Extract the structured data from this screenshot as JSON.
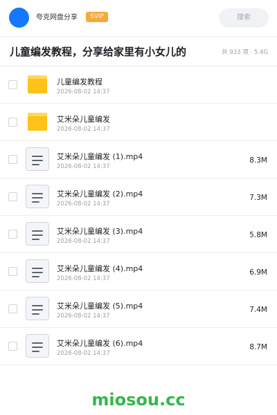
{
  "header": {
    "brand_name": "夸克网盘分享",
    "badge": "SVIP",
    "search_placeholder": "搜索"
  },
  "share": {
    "title": "儿童编发教程，分享给家里有小女儿的",
    "summary": "共 933 项 · 5.4G"
  },
  "files": [
    {
      "type": "folder",
      "name": "儿童编发教程",
      "date": "2026-08-02 14:37",
      "size": ""
    },
    {
      "type": "folder",
      "name": "艾米朵儿童编发",
      "date": "2026-08-02 14:37",
      "size": ""
    },
    {
      "type": "file",
      "name": "艾米朵儿童编发 (1).mp4",
      "date": "2026-08-02 14:37",
      "size": "8.3M"
    },
    {
      "type": "file",
      "name": "艾米朵儿童编发 (2).mp4",
      "date": "2026-08-02 14:37",
      "size": "7.3M"
    },
    {
      "type": "file",
      "name": "艾米朵儿童编发 (3).mp4",
      "date": "2026-08-02 14:37",
      "size": "5.8M"
    },
    {
      "type": "file",
      "name": "艾米朵儿童编发 (4).mp4",
      "date": "2026-08-02 14:37",
      "size": "6.9M"
    },
    {
      "type": "file",
      "name": "艾米朵儿童编发 (5).mp4",
      "date": "2026-08-02 14:37",
      "size": "7.4M"
    },
    {
      "type": "file",
      "name": "艾米朵儿童编发 (6).mp4",
      "date": "2026-08-02 14:37",
      "size": "8.7M"
    }
  ],
  "watermark": "miosou.cc",
  "colors": {
    "accent": "#1677ff",
    "svip": "#f7a93b",
    "folder": "#ffc217",
    "watermark": "#35b64a"
  }
}
